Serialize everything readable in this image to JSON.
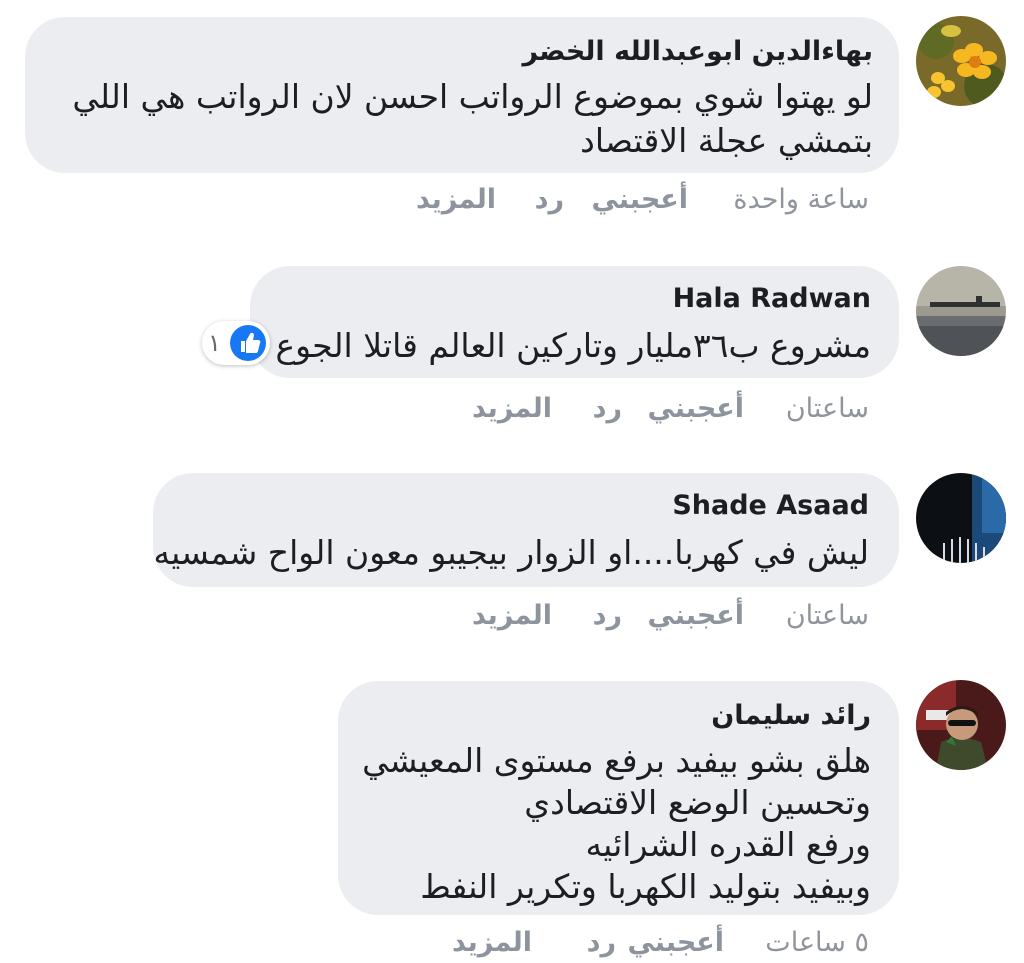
{
  "comments": [
    {
      "author": "بهاءالدين ابوعبدالله الخضر",
      "lines": [
        "لو يهتوا شوي بموضوع الرواتب احسن لان الرواتب هي اللي",
        "بتمشي عجلة الاقتصاد"
      ],
      "time": "ساعة واحدة",
      "like_label": "أعجبني",
      "reply_label": "رد",
      "more_label": "المزيد",
      "avatar": "flower-avatar"
    },
    {
      "author": "Hala Radwan",
      "lines": [
        "مشروع ب٣٦مليار وتاركين العالم قاتلا الجوع"
      ],
      "reaction_count": "١",
      "time": "ساعتان",
      "like_label": "أعجبني",
      "reply_label": "رد",
      "more_label": "المزيد",
      "avatar": "sea-pier-avatar"
    },
    {
      "author": "Shade Asaad",
      "lines": [
        "ليش في كهربا....او الزوار بيجيبو معون الواح شمسيه"
      ],
      "time": "ساعتان",
      "like_label": "أعجبني",
      "reply_label": "رد",
      "more_label": "المزيد",
      "avatar": "dark-abstract-avatar"
    },
    {
      "author": "رائد سليمان",
      "lines": [
        "هلق بشو بيفيد برفع مستوى المعيشي",
        "وتحسين الوضع الاقتصادي",
        "ورفع القدره الشرائيه",
        "وبيفيد بتوليد الكهربا وتكرير النفط"
      ],
      "time": "٥ ساعات",
      "like_label": "أعجبني",
      "reply_label": "رد",
      "more_label": "المزيد",
      "avatar": "man-sunglasses-avatar"
    }
  ],
  "colors": {
    "bubble": "#ebedf0",
    "text": "#1c1e21",
    "meta": "#90949c",
    "like_blue": "#1877f2"
  }
}
